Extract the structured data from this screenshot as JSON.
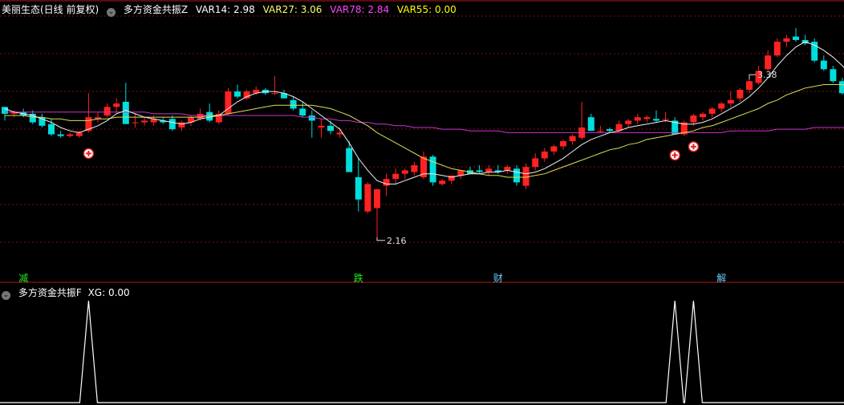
{
  "header": {
    "stock_name": "美丽生态(日线 前复权)",
    "indicator_name": "多方资金共振Z",
    "var14": "VAR14: 2.98",
    "var27": "VAR27: 3.06",
    "var78": "VAR78: 2.84",
    "var55": "VAR55: 0.00",
    "colors": {
      "var14": "#ffffff",
      "var27": "#ffff66",
      "var78": "#ff44ff",
      "var55": "#ffff00"
    }
  },
  "sub_header": {
    "indicator_name": "多方资金共振F",
    "xg": "XG: 0.00"
  },
  "event_tags": [
    {
      "text": "减",
      "color": "#22ee22",
      "index": 2
    },
    {
      "text": "跌",
      "color": "#22ee22",
      "index": 38
    },
    {
      "text": "财",
      "color": "#66ccff",
      "index": 53
    },
    {
      "text": "解",
      "color": "#66ccff",
      "index": 77
    }
  ],
  "chart_data": {
    "type": "candlestick",
    "up_color": "#ff2222",
    "down_color": "#00dddd",
    "ylim": [
      2.0,
      3.45
    ],
    "high_label": "3.38",
    "low_label": "2.16",
    "high_index": 80,
    "low_index": 40,
    "candles": [
      [
        2.92,
        2.92,
        2.84,
        2.88
      ],
      [
        2.88,
        2.9,
        2.86,
        2.89
      ],
      [
        2.89,
        2.91,
        2.86,
        2.87
      ],
      [
        2.88,
        2.9,
        2.82,
        2.83
      ],
      [
        2.86,
        2.88,
        2.8,
        2.81
      ],
      [
        2.82,
        2.85,
        2.75,
        2.76
      ],
      [
        2.76,
        2.78,
        2.74,
        2.75
      ],
      [
        2.75,
        2.77,
        2.74,
        2.76
      ],
      [
        2.75,
        2.78,
        2.74,
        2.77
      ],
      [
        2.78,
        3.0,
        2.77,
        2.86
      ],
      [
        2.85,
        2.89,
        2.83,
        2.86
      ],
      [
        2.87,
        2.94,
        2.86,
        2.92
      ],
      [
        2.92,
        2.97,
        2.88,
        2.94
      ],
      [
        2.95,
        3.06,
        2.82,
        2.82
      ],
      [
        2.83,
        2.88,
        2.8,
        2.83
      ],
      [
        2.83,
        2.86,
        2.81,
        2.84
      ],
      [
        2.83,
        2.87,
        2.81,
        2.85
      ],
      [
        2.84,
        2.86,
        2.82,
        2.83
      ],
      [
        2.85,
        2.87,
        2.78,
        2.79
      ],
      [
        2.8,
        2.84,
        2.78,
        2.83
      ],
      [
        2.83,
        2.87,
        2.81,
        2.86
      ],
      [
        2.85,
        2.91,
        2.84,
        2.88
      ],
      [
        2.89,
        2.94,
        2.83,
        2.84
      ],
      [
        2.83,
        2.9,
        2.82,
        2.88
      ],
      [
        2.88,
        3.03,
        2.87,
        3.01
      ],
      [
        3.01,
        3.05,
        2.97,
        2.98
      ],
      [
        2.97,
        3.02,
        2.96,
        3.01
      ],
      [
        3.0,
        3.04,
        2.99,
        3.02
      ],
      [
        3.02,
        3.03,
        2.99,
        3.0
      ],
      [
        3.0,
        3.1,
        2.99,
        3.0
      ],
      [
        3.0,
        3.02,
        2.97,
        2.97
      ],
      [
        2.96,
        2.98,
        2.9,
        2.91
      ],
      [
        2.91,
        2.95,
        2.86,
        2.87
      ],
      [
        2.87,
        2.9,
        2.74,
        2.84
      ],
      [
        2.8,
        2.85,
        2.74,
        2.81
      ],
      [
        2.81,
        2.84,
        2.76,
        2.78
      ],
      [
        2.76,
        2.8,
        2.74,
        2.77
      ],
      [
        2.68,
        2.72,
        2.54,
        2.54
      ],
      [
        2.51,
        2.62,
        2.31,
        2.38
      ],
      [
        2.31,
        2.48,
        2.3,
        2.47
      ],
      [
        2.33,
        2.44,
        2.16,
        2.44
      ],
      [
        2.46,
        2.53,
        2.4,
        2.5
      ],
      [
        2.5,
        2.56,
        2.47,
        2.53
      ],
      [
        2.53,
        2.56,
        2.5,
        2.55
      ],
      [
        2.54,
        2.6,
        2.52,
        2.58
      ],
      [
        2.51,
        2.66,
        2.5,
        2.63
      ],
      [
        2.63,
        2.64,
        2.46,
        2.48
      ],
      [
        2.47,
        2.5,
        2.46,
        2.49
      ],
      [
        2.49,
        2.51,
        2.47,
        2.52
      ],
      [
        2.52,
        2.55,
        2.5,
        2.55
      ],
      [
        2.55,
        2.57,
        2.53,
        2.53
      ],
      [
        2.55,
        2.58,
        2.53,
        2.54
      ],
      [
        2.54,
        2.58,
        2.52,
        2.56
      ],
      [
        2.55,
        2.58,
        2.53,
        2.54
      ],
      [
        2.55,
        2.58,
        2.53,
        2.57
      ],
      [
        2.56,
        2.58,
        2.46,
        2.48
      ],
      [
        2.46,
        2.59,
        2.44,
        2.57
      ],
      [
        2.57,
        2.65,
        2.55,
        2.62
      ],
      [
        2.62,
        2.68,
        2.6,
        2.66
      ],
      [
        2.66,
        2.7,
        2.64,
        2.69
      ],
      [
        2.69,
        2.73,
        2.67,
        2.72
      ],
      [
        2.72,
        2.76,
        2.7,
        2.75
      ],
      [
        2.74,
        2.95,
        2.73,
        2.8
      ],
      [
        2.86,
        2.88,
        2.78,
        2.78
      ],
      [
        2.78,
        2.81,
        2.77,
        2.78
      ],
      [
        2.79,
        2.8,
        2.77,
        2.78
      ],
      [
        2.78,
        2.84,
        2.77,
        2.82
      ],
      [
        2.82,
        2.85,
        2.8,
        2.84
      ],
      [
        2.84,
        2.88,
        2.82,
        2.86
      ],
      [
        2.85,
        2.87,
        2.83,
        2.86
      ],
      [
        2.85,
        2.9,
        2.83,
        2.84
      ],
      [
        2.85,
        2.89,
        2.83,
        2.85
      ],
      [
        2.84,
        2.86,
        2.76,
        2.76
      ],
      [
        2.76,
        2.84,
        2.75,
        2.83
      ],
      [
        2.83,
        2.88,
        2.81,
        2.87
      ],
      [
        2.86,
        2.89,
        2.84,
        2.88
      ],
      [
        2.88,
        2.92,
        2.86,
        2.91
      ],
      [
        2.91,
        2.95,
        2.89,
        2.94
      ],
      [
        2.94,
        3.01,
        2.92,
        2.96
      ],
      [
        2.97,
        3.03,
        2.95,
        3.02
      ],
      [
        3.02,
        3.08,
        3.0,
        3.07
      ],
      [
        3.06,
        3.16,
        3.05,
        3.13
      ],
      [
        3.14,
        3.25,
        3.13,
        3.22
      ],
      [
        3.22,
        3.32,
        3.21,
        3.3
      ],
      [
        3.3,
        3.34,
        3.27,
        3.32
      ],
      [
        3.33,
        3.38,
        3.3,
        3.31
      ],
      [
        3.31,
        3.34,
        3.28,
        3.29
      ],
      [
        3.3,
        3.32,
        3.18,
        3.19
      ],
      [
        3.19,
        3.22,
        3.13,
        3.14
      ],
      [
        3.14,
        3.16,
        3.06,
        3.07
      ],
      [
        3.07,
        3.09,
        2.99,
        3.0
      ],
      [
        3.0,
        3.02,
        2.93,
        2.94
      ],
      [
        2.94,
        2.96,
        2.88,
        2.89
      ],
      [
        2.88,
        2.92,
        2.84,
        2.89
      ]
    ],
    "ma_white": [
      2.91,
      2.89,
      2.88,
      2.87,
      2.85,
      2.83,
      2.8,
      2.78,
      2.77,
      2.79,
      2.81,
      2.84,
      2.88,
      2.9,
      2.88,
      2.86,
      2.85,
      2.84,
      2.83,
      2.82,
      2.83,
      2.85,
      2.86,
      2.87,
      2.91,
      2.95,
      2.98,
      3.0,
      3.01,
      3.01,
      3.0,
      2.98,
      2.95,
      2.91,
      2.87,
      2.83,
      2.79,
      2.71,
      2.62,
      2.55,
      2.49,
      2.47,
      2.47,
      2.49,
      2.51,
      2.53,
      2.53,
      2.52,
      2.51,
      2.52,
      2.53,
      2.53,
      2.54,
      2.54,
      2.55,
      2.54,
      2.53,
      2.54,
      2.56,
      2.59,
      2.62,
      2.66,
      2.7,
      2.73,
      2.75,
      2.77,
      2.78,
      2.8,
      2.81,
      2.82,
      2.83,
      2.84,
      2.83,
      2.82,
      2.82,
      2.83,
      2.85,
      2.88,
      2.91,
      2.94,
      2.98,
      3.03,
      3.09,
      3.16,
      3.22,
      3.27,
      3.3,
      3.28,
      3.25,
      3.21,
      3.16,
      3.1,
      3.04,
      2.98
    ],
    "ma_yellow": [
      2.87,
      2.87,
      2.87,
      2.86,
      2.86,
      2.85,
      2.85,
      2.84,
      2.84,
      2.84,
      2.85,
      2.85,
      2.86,
      2.86,
      2.86,
      2.86,
      2.86,
      2.86,
      2.86,
      2.86,
      2.86,
      2.86,
      2.87,
      2.87,
      2.88,
      2.89,
      2.9,
      2.91,
      2.92,
      2.93,
      2.93,
      2.93,
      2.93,
      2.93,
      2.92,
      2.91,
      2.89,
      2.87,
      2.84,
      2.81,
      2.77,
      2.74,
      2.71,
      2.68,
      2.65,
      2.62,
      2.6,
      2.58,
      2.56,
      2.55,
      2.54,
      2.53,
      2.52,
      2.52,
      2.51,
      2.51,
      2.51,
      2.52,
      2.53,
      2.55,
      2.57,
      2.59,
      2.61,
      2.63,
      2.65,
      2.67,
      2.68,
      2.7,
      2.71,
      2.73,
      2.74,
      2.75,
      2.76,
      2.77,
      2.78,
      2.8,
      2.81,
      2.83,
      2.85,
      2.87,
      2.89,
      2.91,
      2.94,
      2.96,
      2.99,
      3.01,
      3.03,
      3.04,
      3.05,
      3.05,
      3.05,
      3.04,
      3.03,
      3.02
    ],
    "ma_magenta": [
      2.89,
      2.89,
      2.89,
      2.89,
      2.89,
      2.89,
      2.89,
      2.89,
      2.89,
      2.89,
      2.89,
      2.89,
      2.89,
      2.89,
      2.89,
      2.89,
      2.88,
      2.88,
      2.88,
      2.88,
      2.87,
      2.87,
      2.87,
      2.87,
      2.87,
      2.87,
      2.87,
      2.87,
      2.87,
      2.87,
      2.87,
      2.87,
      2.86,
      2.86,
      2.85,
      2.85,
      2.84,
      2.84,
      2.83,
      2.83,
      2.82,
      2.82,
      2.81,
      2.81,
      2.8,
      2.8,
      2.8,
      2.79,
      2.79,
      2.79,
      2.78,
      2.78,
      2.78,
      2.78,
      2.77,
      2.77,
      2.77,
      2.77,
      2.77,
      2.77,
      2.77,
      2.77,
      2.77,
      2.77,
      2.77,
      2.77,
      2.77,
      2.77,
      2.77,
      2.77,
      2.77,
      2.77,
      2.77,
      2.77,
      2.77,
      2.77,
      2.77,
      2.77,
      2.78,
      2.78,
      2.78,
      2.78,
      2.78,
      2.79,
      2.79,
      2.79,
      2.79,
      2.8,
      2.8,
      2.8,
      2.8,
      2.8,
      2.8,
      2.8
    ],
    "buy_signal_indices": [
      9,
      72,
      74
    ],
    "xg_signal": {
      "ylim": [
        0,
        1
      ],
      "values_ones_at": [
        9,
        72,
        74
      ]
    }
  }
}
